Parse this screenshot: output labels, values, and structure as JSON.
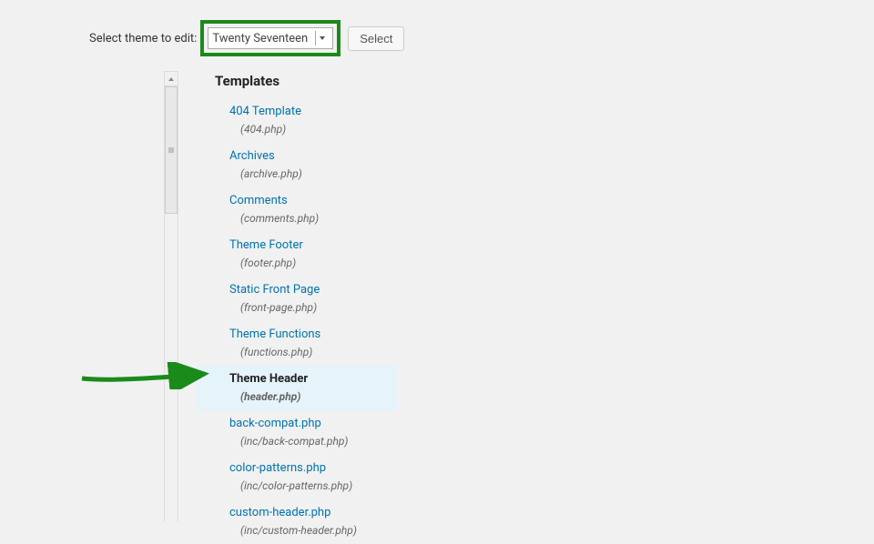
{
  "topbar": {
    "label": "Select theme to edit:",
    "selected_theme": "Twenty Seventeen",
    "select_button": "Select"
  },
  "section": {
    "title": "Templates"
  },
  "files": [
    {
      "name": "404 Template",
      "path": "(404.php)",
      "selected": false
    },
    {
      "name": "Archives",
      "path": "(archive.php)",
      "selected": false
    },
    {
      "name": "Comments",
      "path": "(comments.php)",
      "selected": false
    },
    {
      "name": "Theme Footer",
      "path": "(footer.php)",
      "selected": false
    },
    {
      "name": "Static Front Page",
      "path": "(front-page.php)",
      "selected": false
    },
    {
      "name": "Theme Functions",
      "path": "(functions.php)",
      "selected": false
    },
    {
      "name": "Theme Header",
      "path": "(header.php)",
      "selected": true
    },
    {
      "name": "back-compat.php",
      "path": "(inc/back-compat.php)",
      "selected": false
    },
    {
      "name": "color-patterns.php",
      "path": "(inc/color-patterns.php)",
      "selected": false
    },
    {
      "name": "custom-header.php",
      "path": "(inc/custom-header.php)",
      "selected": false
    }
  ]
}
